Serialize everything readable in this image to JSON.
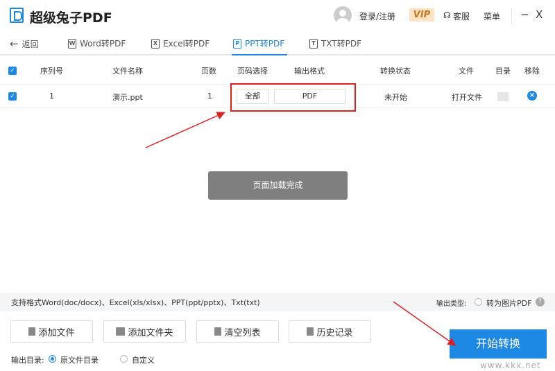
{
  "app": {
    "title": "超级兔子PDF",
    "login": "登录/注册",
    "vip": "VIP",
    "service": "客服",
    "menu": "菜单",
    "minimize": "−",
    "close": "X"
  },
  "tabs": {
    "back": "返回",
    "items": [
      {
        "icon": "W",
        "label": "Word转PDF"
      },
      {
        "icon": "X",
        "label": "Excel转PDF"
      },
      {
        "icon": "P",
        "label": "PPT转PDF"
      },
      {
        "icon": "T",
        "label": "TXT转PDF"
      }
    ]
  },
  "table": {
    "headers": [
      "序列号",
      "文件名称",
      "页数",
      "页码选择",
      "输出格式",
      "转换状态",
      "文件",
      "目录",
      "移除"
    ],
    "rows": [
      {
        "index": "1",
        "name": "演示.ppt",
        "pages": "1",
        "page_select": "全部",
        "format": "PDF",
        "status": "未开始",
        "file": "打开文件"
      }
    ]
  },
  "toast": "页面加载完成",
  "info": {
    "formats": "支持格式Word(doc/docx)、Excel(xls/xlsx)、PPT(ppt/pptx)、Txt(txt)",
    "output_type_label": "输出类型:",
    "image_pdf": "转为图片PDF",
    "help": "?"
  },
  "buttons": {
    "add_file": "添加文件",
    "add_folder": "添加文件夹",
    "clear": "清空列表",
    "history": "历史记录",
    "start": "开始转换"
  },
  "output_dir": {
    "label": "输出目录:",
    "original": "原文件目录",
    "custom": "自定义"
  },
  "watermark": "www.kkx.net"
}
